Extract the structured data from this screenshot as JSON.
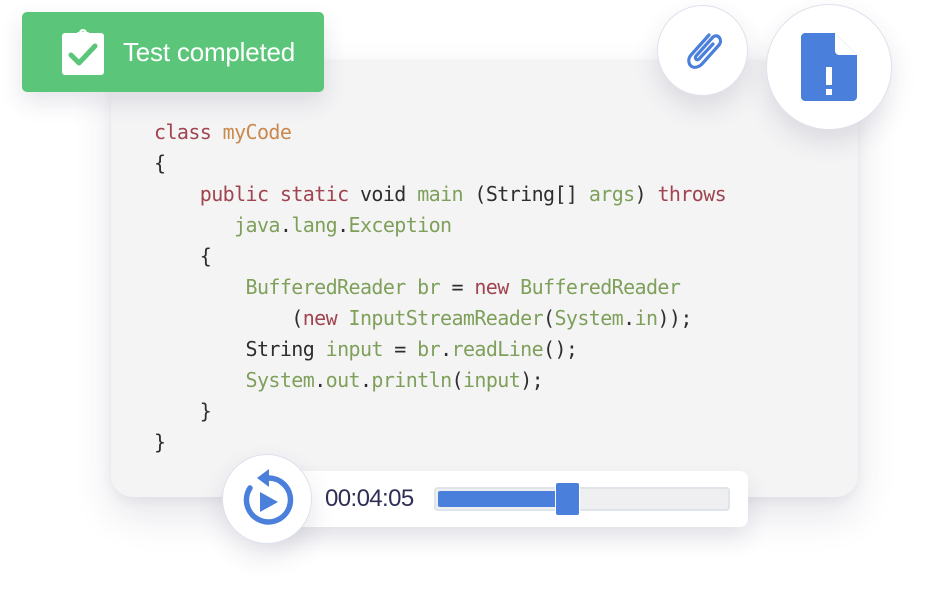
{
  "badge": {
    "label": "Test completed",
    "icon": "clipboard-check-icon",
    "color": "#5bc67a"
  },
  "actions": {
    "attach_icon": "paperclip-icon",
    "file_icon": "file-alert-icon",
    "accent": "#4a80dc"
  },
  "code": {
    "lines": [
      [
        {
          "t": "class",
          "c": "kw"
        },
        {
          "t": " ",
          "c": "plain"
        },
        {
          "t": "myCode",
          "c": "cls"
        }
      ],
      [
        {
          "t": "{",
          "c": "plain"
        }
      ],
      [
        {
          "t": "    ",
          "c": "plain"
        },
        {
          "t": "public",
          "c": "kw"
        },
        {
          "t": " ",
          "c": "plain"
        },
        {
          "t": "static",
          "c": "kw"
        },
        {
          "t": " void ",
          "c": "plain"
        },
        {
          "t": "main",
          "c": "id"
        },
        {
          "t": " (String[] ",
          "c": "plain"
        },
        {
          "t": "args",
          "c": "id"
        },
        {
          "t": ") ",
          "c": "plain"
        },
        {
          "t": "throws",
          "c": "kw"
        }
      ],
      [
        {
          "t": "       ",
          "c": "plain"
        },
        {
          "t": "java",
          "c": "id"
        },
        {
          "t": ".",
          "c": "plain"
        },
        {
          "t": "lang",
          "c": "id"
        },
        {
          "t": ".",
          "c": "plain"
        },
        {
          "t": "Exception",
          "c": "id"
        }
      ],
      [
        {
          "t": "    {",
          "c": "plain"
        }
      ],
      [
        {
          "t": "        ",
          "c": "plain"
        },
        {
          "t": "BufferedReader br",
          "c": "id"
        },
        {
          "t": " = ",
          "c": "plain"
        },
        {
          "t": "new",
          "c": "kw"
        },
        {
          "t": " ",
          "c": "plain"
        },
        {
          "t": "BufferedReader",
          "c": "id"
        }
      ],
      [
        {
          "t": "            (",
          "c": "plain"
        },
        {
          "t": "new",
          "c": "kw"
        },
        {
          "t": " ",
          "c": "plain"
        },
        {
          "t": "InputStreamReader",
          "c": "id"
        },
        {
          "t": "(",
          "c": "plain"
        },
        {
          "t": "System",
          "c": "id"
        },
        {
          "t": ".",
          "c": "plain"
        },
        {
          "t": "in",
          "c": "id"
        },
        {
          "t": "));",
          "c": "plain"
        }
      ],
      [
        {
          "t": "        String ",
          "c": "plain"
        },
        {
          "t": "input",
          "c": "id"
        },
        {
          "t": " = ",
          "c": "plain"
        },
        {
          "t": "br",
          "c": "id"
        },
        {
          "t": ".",
          "c": "plain"
        },
        {
          "t": "readLine",
          "c": "id"
        },
        {
          "t": "();",
          "c": "plain"
        }
      ],
      [
        {
          "t": "        ",
          "c": "plain"
        },
        {
          "t": "System",
          "c": "id"
        },
        {
          "t": ".",
          "c": "plain"
        },
        {
          "t": "out",
          "c": "id"
        },
        {
          "t": ".",
          "c": "plain"
        },
        {
          "t": "println",
          "c": "id"
        },
        {
          "t": "(",
          "c": "plain"
        },
        {
          "t": "input",
          "c": "id"
        },
        {
          "t": ");",
          "c": "plain"
        }
      ],
      [
        {
          "t": "    }",
          "c": "plain"
        }
      ],
      [
        {
          "t": "}",
          "c": "plain"
        }
      ]
    ]
  },
  "player": {
    "time": "00:04:05",
    "progress": 0.42,
    "replay_icon": "replay-icon"
  }
}
